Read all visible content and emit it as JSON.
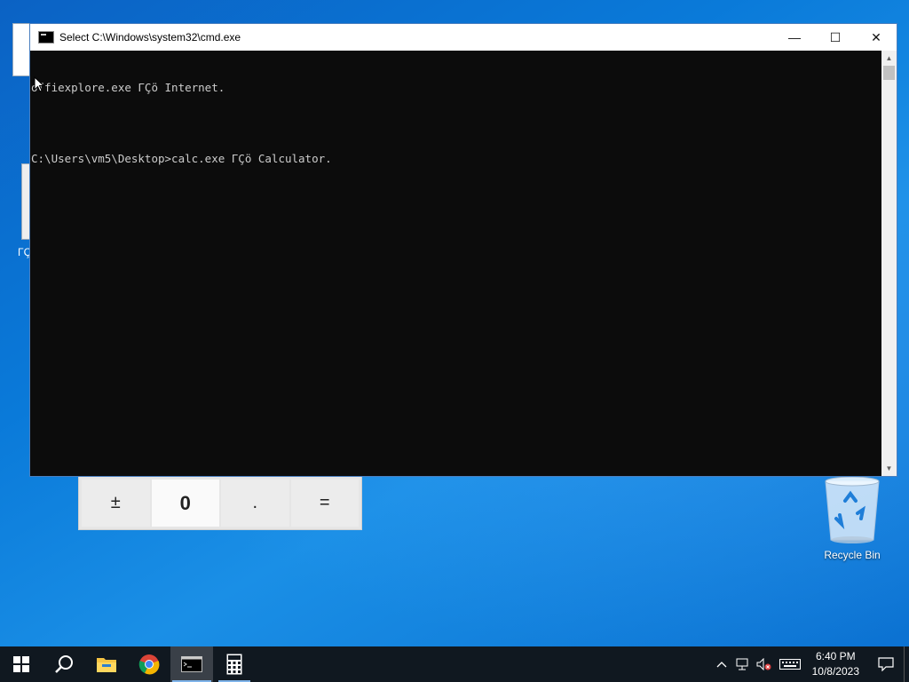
{
  "window": {
    "title": "Select C:\\Windows\\system32\\cmd.exe",
    "minimize_glyph": "—",
    "maximize_glyph": "☐",
    "close_glyph": "✕"
  },
  "console": {
    "lines": [
      "offiexplore.exe ΓÇö Internet.",
      "",
      "C:\\Users\\vm5\\Desktop>calc.exe ΓÇö Calculator."
    ]
  },
  "calculator": {
    "keys": [
      "±",
      "0",
      ".",
      "="
    ]
  },
  "desktop": {
    "recycle_bin_label": "Recycle Bin",
    "partial_icon_text": "ΓÇ"
  },
  "taskbar": {
    "icons": [
      "windows-start-icon",
      "search-icon",
      "file-explorer-icon",
      "chrome-icon",
      "cmd-icon",
      "calculator-icon"
    ],
    "clock_time": "6:40 PM",
    "clock_date": "10/8/2023"
  },
  "colors": {
    "console_bg": "#0c0c0c",
    "console_text": "#cccccc",
    "taskbar_bg": "#101820",
    "desktop_accent": "#0a7ad9"
  }
}
